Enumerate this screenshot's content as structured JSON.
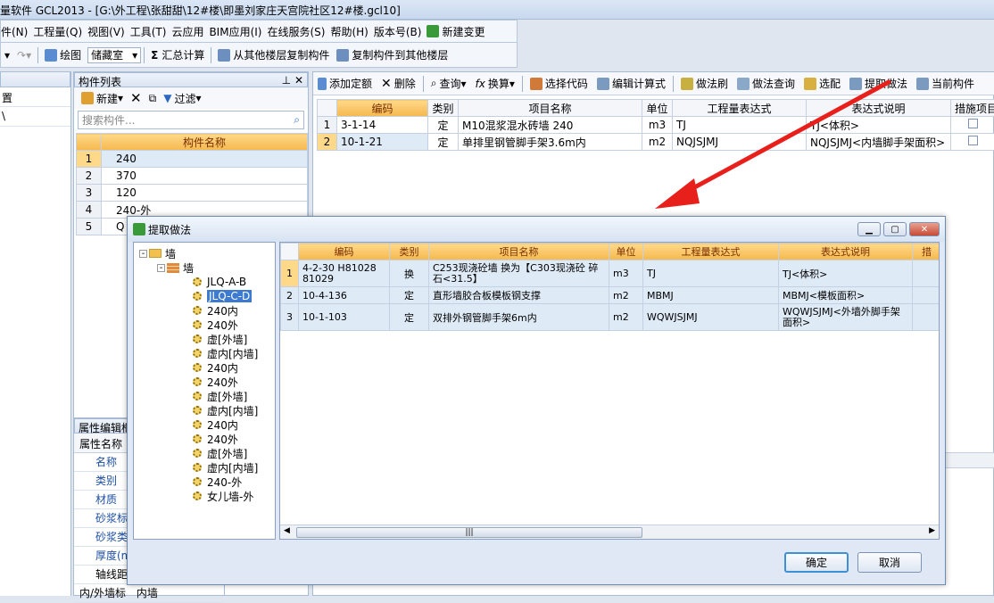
{
  "window": {
    "title": "量软件 GCL2013 - [G:\\外工程\\张甜甜\\12#楼\\即墨刘家庄天宫院社区12#楼.gcl10]"
  },
  "menu": {
    "items": [
      "件(N)",
      "工程量(Q)",
      "视图(V)",
      "工具(T)",
      "云应用",
      "BIM应用(I)",
      "在线服务(S)",
      "帮助(H)",
      "版本号(B)",
      "新建变更"
    ]
  },
  "toolbar": {
    "draw": "绘图",
    "layer_value": "储藏室",
    "sum": "汇总计算",
    "copy_from": "从其他楼层复制构件",
    "copy_to": "复制构件到其他楼层"
  },
  "left_pane": {
    "item1": "置",
    "item2": "\\"
  },
  "component_list": {
    "title": "构件列表",
    "new": "新建",
    "filter": "过滤",
    "search_placeholder": "搜索构件...",
    "header": "构件名称",
    "rows": [
      {
        "n": "1",
        "name": "240"
      },
      {
        "n": "2",
        "name": "370"
      },
      {
        "n": "3",
        "name": "120"
      },
      {
        "n": "4",
        "name": "240-外"
      },
      {
        "n": "5",
        "name": "Q"
      }
    ]
  },
  "attr": {
    "title": "属性编辑框",
    "header": "属性名称",
    "items": [
      "名称",
      "类别",
      "材质",
      "砂浆标号",
      "砂浆类型",
      "厚度(mm)",
      "轴线距",
      "内/外墙标"
    ],
    "last_value": "内墙"
  },
  "main_toolbar": {
    "add": "添加定额",
    "delete": "删除",
    "query": "查询",
    "convert": "换算",
    "select_code": "选择代码",
    "edit_expr": "编辑计算式",
    "brush": "做法刷",
    "method_query": "做法查询",
    "select_pair": "选配",
    "extract": "提取做法",
    "current": "当前构件"
  },
  "main_grid": {
    "headers": [
      "编码",
      "类别",
      "项目名称",
      "单位",
      "工程量表达式",
      "表达式说明",
      "措施项目"
    ],
    "rows": [
      {
        "n": "1",
        "code": "3-1-14",
        "type": "定",
        "name": "M10混浆混水砖墙 240",
        "unit": "m3",
        "expr": "TJ",
        "desc": "TJ<体积>"
      },
      {
        "n": "2",
        "code": "10-1-21",
        "type": "定",
        "name": "单排里钢管脚手架3.6m内",
        "unit": "m2",
        "expr": "NQJSJMJ",
        "desc": "NQJSJMJ<内墙脚手架面积>"
      }
    ]
  },
  "dialog": {
    "title": "提取做法",
    "tree": {
      "root": "墙",
      "child": "墙",
      "items": [
        "JLQ-A-B",
        "JLQ-C-D",
        "240内",
        "240外",
        "虚[外墙]",
        "虚内[内墙]",
        "240内",
        "240外",
        "虚[外墙]",
        "虚内[内墙]",
        "240内",
        "240外",
        "虚[外墙]",
        "虚内[内墙]",
        "240-外",
        "女儿墙-外"
      ]
    },
    "grid_headers": [
      "编码",
      "类别",
      "项目名称",
      "单位",
      "工程量表达式",
      "表达式说明",
      "措"
    ],
    "rows": [
      {
        "n": "1",
        "code": "4-2-30 H81028 81029",
        "type": "换",
        "name": "C253现浇砼墙 换为【C303现浇砼 碎石<31.5】",
        "unit": "m3",
        "expr": "TJ",
        "desc": "TJ<体积>"
      },
      {
        "n": "2",
        "code": "10-4-136",
        "type": "定",
        "name": "直形墙胶合板模板钢支撑",
        "unit": "m2",
        "expr": "MBMJ",
        "desc": "MBMJ<模板面积>"
      },
      {
        "n": "3",
        "code": "10-1-103",
        "type": "定",
        "name": "双排外钢管脚手架6m内",
        "unit": "m2",
        "expr": "WQWJSJMJ",
        "desc": "WQWJSJMJ<外墙外脚手架面积>"
      }
    ],
    "ok": "确定",
    "cancel": "取消"
  }
}
